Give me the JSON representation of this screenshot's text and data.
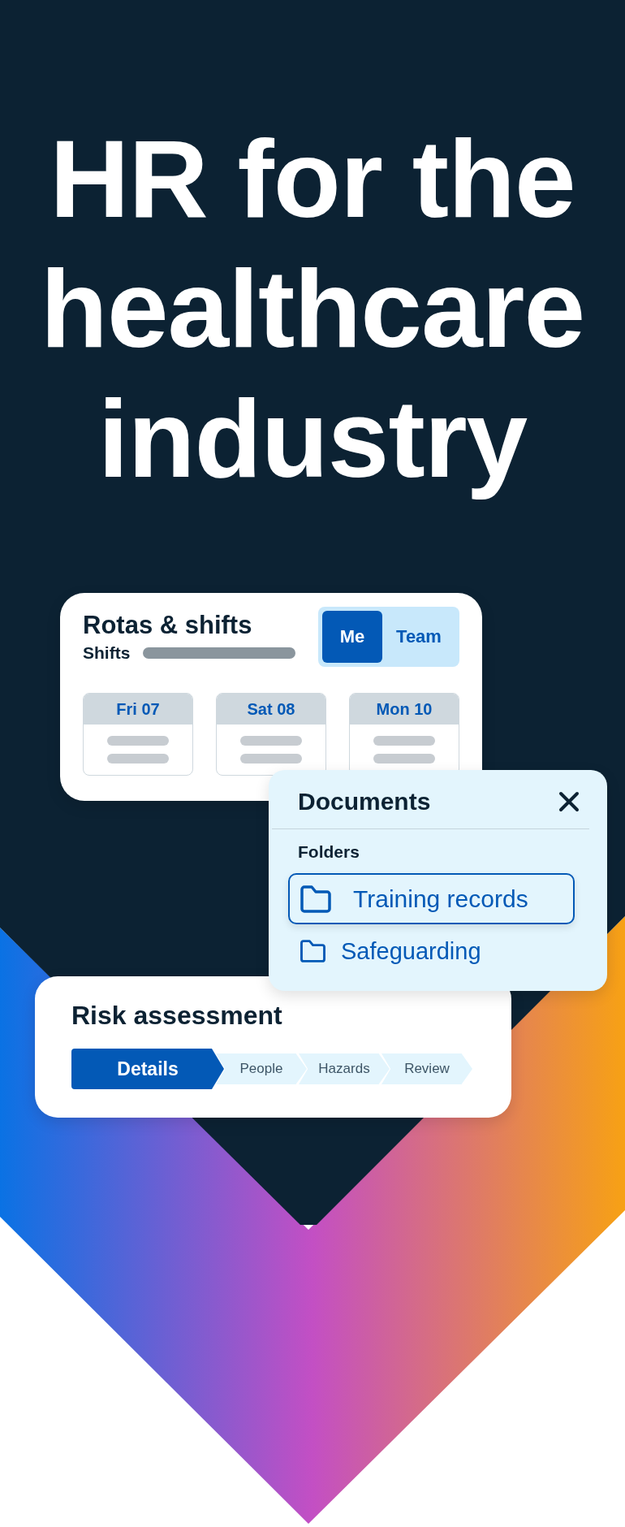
{
  "headline": "HR for the healthcare industry",
  "rotas_card": {
    "title": "Rotas & shifts",
    "subtitle": "Shifts",
    "toggle": [
      {
        "label": "Me",
        "selected": true
      },
      {
        "label": "Team",
        "selected": false
      }
    ],
    "days": [
      {
        "label": "Fri 07"
      },
      {
        "label": "Sat 08"
      },
      {
        "label": "Mon 10"
      }
    ]
  },
  "documents_card": {
    "title": "Documents",
    "section": "Folders",
    "folders": [
      {
        "label": "Training records",
        "selected": true
      },
      {
        "label": "Safeguarding",
        "selected": false
      }
    ]
  },
  "risk_card": {
    "title": "Risk assessment",
    "steps": [
      {
        "label": "Details",
        "selected": true
      },
      {
        "label": "People",
        "selected": false
      },
      {
        "label": "Hazards",
        "selected": false
      },
      {
        "label": "Review",
        "selected": false
      }
    ]
  }
}
